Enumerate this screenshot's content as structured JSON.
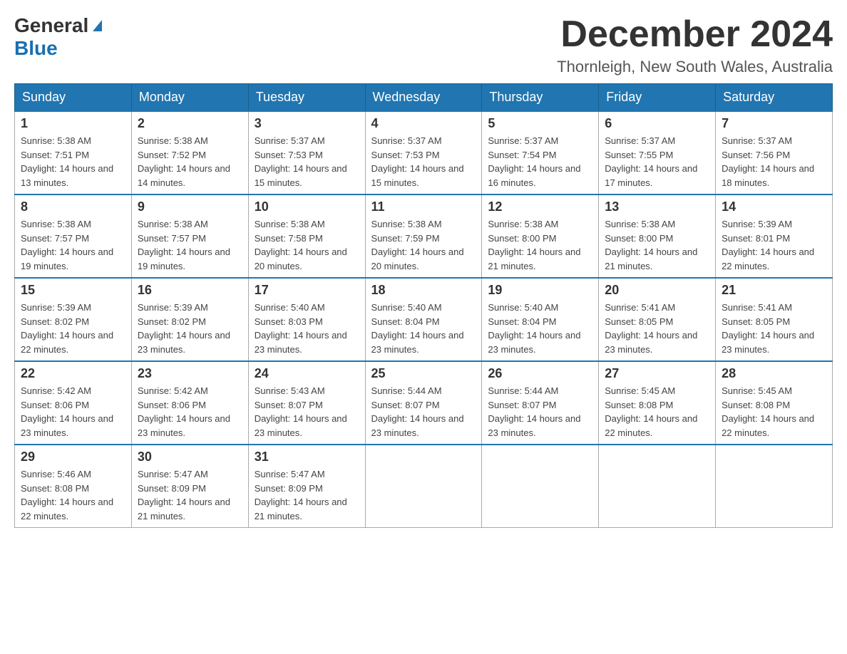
{
  "header": {
    "logo_general": "General",
    "logo_blue": "Blue",
    "month_year": "December 2024",
    "location": "Thornleigh, New South Wales, Australia"
  },
  "weekdays": [
    "Sunday",
    "Monday",
    "Tuesday",
    "Wednesday",
    "Thursday",
    "Friday",
    "Saturday"
  ],
  "weeks": [
    [
      {
        "day": "1",
        "sunrise": "5:38 AM",
        "sunset": "7:51 PM",
        "daylight": "14 hours and 13 minutes."
      },
      {
        "day": "2",
        "sunrise": "5:38 AM",
        "sunset": "7:52 PM",
        "daylight": "14 hours and 14 minutes."
      },
      {
        "day": "3",
        "sunrise": "5:37 AM",
        "sunset": "7:53 PM",
        "daylight": "14 hours and 15 minutes."
      },
      {
        "day": "4",
        "sunrise": "5:37 AM",
        "sunset": "7:53 PM",
        "daylight": "14 hours and 15 minutes."
      },
      {
        "day": "5",
        "sunrise": "5:37 AM",
        "sunset": "7:54 PM",
        "daylight": "14 hours and 16 minutes."
      },
      {
        "day": "6",
        "sunrise": "5:37 AM",
        "sunset": "7:55 PM",
        "daylight": "14 hours and 17 minutes."
      },
      {
        "day": "7",
        "sunrise": "5:37 AM",
        "sunset": "7:56 PM",
        "daylight": "14 hours and 18 minutes."
      }
    ],
    [
      {
        "day": "8",
        "sunrise": "5:38 AM",
        "sunset": "7:57 PM",
        "daylight": "14 hours and 19 minutes."
      },
      {
        "day": "9",
        "sunrise": "5:38 AM",
        "sunset": "7:57 PM",
        "daylight": "14 hours and 19 minutes."
      },
      {
        "day": "10",
        "sunrise": "5:38 AM",
        "sunset": "7:58 PM",
        "daylight": "14 hours and 20 minutes."
      },
      {
        "day": "11",
        "sunrise": "5:38 AM",
        "sunset": "7:59 PM",
        "daylight": "14 hours and 20 minutes."
      },
      {
        "day": "12",
        "sunrise": "5:38 AM",
        "sunset": "8:00 PM",
        "daylight": "14 hours and 21 minutes."
      },
      {
        "day": "13",
        "sunrise": "5:38 AM",
        "sunset": "8:00 PM",
        "daylight": "14 hours and 21 minutes."
      },
      {
        "day": "14",
        "sunrise": "5:39 AM",
        "sunset": "8:01 PM",
        "daylight": "14 hours and 22 minutes."
      }
    ],
    [
      {
        "day": "15",
        "sunrise": "5:39 AM",
        "sunset": "8:02 PM",
        "daylight": "14 hours and 22 minutes."
      },
      {
        "day": "16",
        "sunrise": "5:39 AM",
        "sunset": "8:02 PM",
        "daylight": "14 hours and 23 minutes."
      },
      {
        "day": "17",
        "sunrise": "5:40 AM",
        "sunset": "8:03 PM",
        "daylight": "14 hours and 23 minutes."
      },
      {
        "day": "18",
        "sunrise": "5:40 AM",
        "sunset": "8:04 PM",
        "daylight": "14 hours and 23 minutes."
      },
      {
        "day": "19",
        "sunrise": "5:40 AM",
        "sunset": "8:04 PM",
        "daylight": "14 hours and 23 minutes."
      },
      {
        "day": "20",
        "sunrise": "5:41 AM",
        "sunset": "8:05 PM",
        "daylight": "14 hours and 23 minutes."
      },
      {
        "day": "21",
        "sunrise": "5:41 AM",
        "sunset": "8:05 PM",
        "daylight": "14 hours and 23 minutes."
      }
    ],
    [
      {
        "day": "22",
        "sunrise": "5:42 AM",
        "sunset": "8:06 PM",
        "daylight": "14 hours and 23 minutes."
      },
      {
        "day": "23",
        "sunrise": "5:42 AM",
        "sunset": "8:06 PM",
        "daylight": "14 hours and 23 minutes."
      },
      {
        "day": "24",
        "sunrise": "5:43 AM",
        "sunset": "8:07 PM",
        "daylight": "14 hours and 23 minutes."
      },
      {
        "day": "25",
        "sunrise": "5:44 AM",
        "sunset": "8:07 PM",
        "daylight": "14 hours and 23 minutes."
      },
      {
        "day": "26",
        "sunrise": "5:44 AM",
        "sunset": "8:07 PM",
        "daylight": "14 hours and 23 minutes."
      },
      {
        "day": "27",
        "sunrise": "5:45 AM",
        "sunset": "8:08 PM",
        "daylight": "14 hours and 22 minutes."
      },
      {
        "day": "28",
        "sunrise": "5:45 AM",
        "sunset": "8:08 PM",
        "daylight": "14 hours and 22 minutes."
      }
    ],
    [
      {
        "day": "29",
        "sunrise": "5:46 AM",
        "sunset": "8:08 PM",
        "daylight": "14 hours and 22 minutes."
      },
      {
        "day": "30",
        "sunrise": "5:47 AM",
        "sunset": "8:09 PM",
        "daylight": "14 hours and 21 minutes."
      },
      {
        "day": "31",
        "sunrise": "5:47 AM",
        "sunset": "8:09 PM",
        "daylight": "14 hours and 21 minutes."
      },
      null,
      null,
      null,
      null
    ]
  ]
}
